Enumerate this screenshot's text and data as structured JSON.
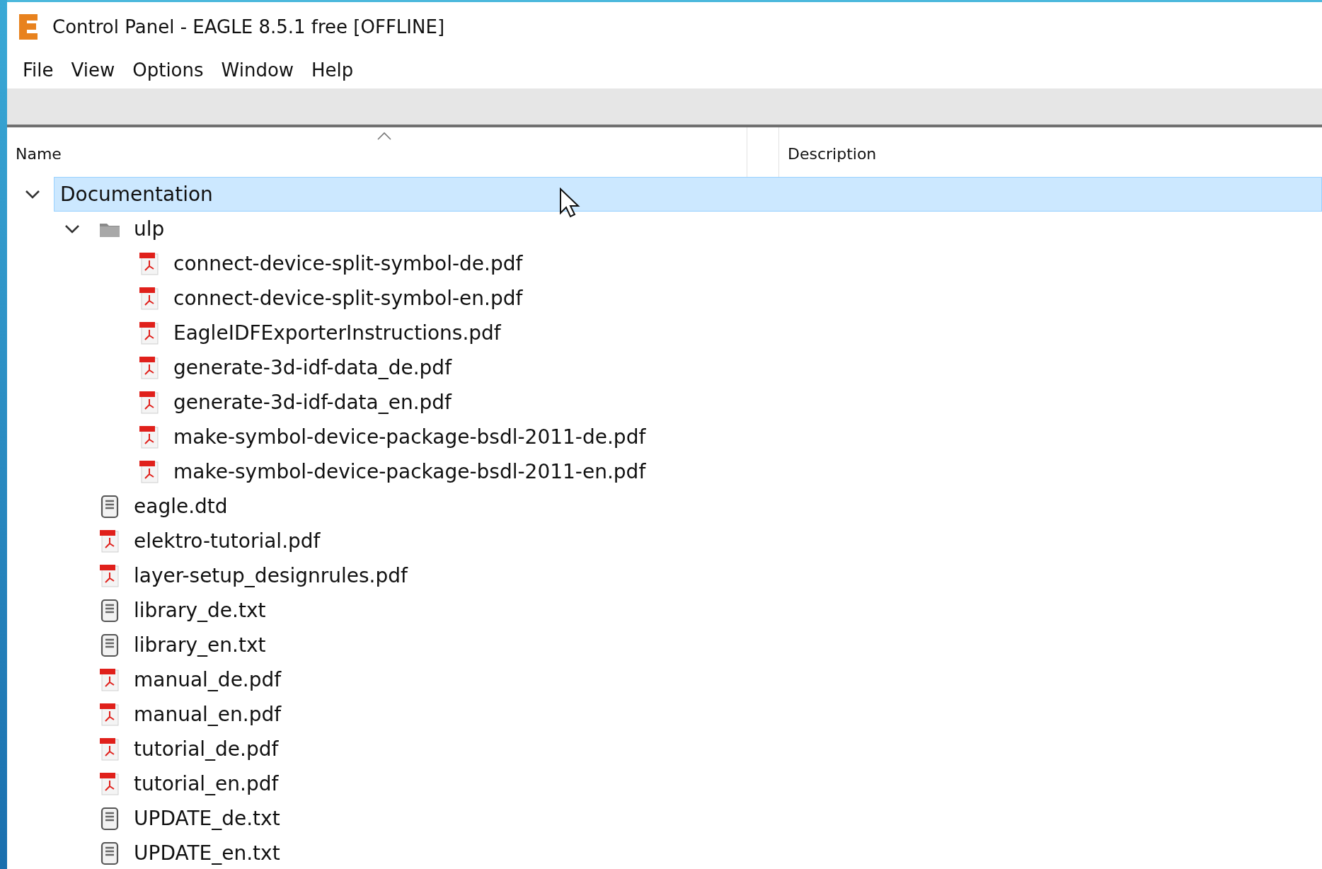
{
  "window": {
    "title": "Control Panel - EAGLE 8.5.1 free [OFFLINE]"
  },
  "menu": [
    "File",
    "View",
    "Options",
    "Window",
    "Help"
  ],
  "columns": [
    {
      "label": "Name",
      "sorted": true
    },
    {
      "label": "Description",
      "sorted": false
    }
  ],
  "tree": [
    {
      "name": "Documentation",
      "expanded": true,
      "selected": true,
      "children": [
        {
          "name": "ulp",
          "kind": "folder",
          "expanded": true,
          "selected": false,
          "children": [
            {
              "name": "connect-device-split-symbol-de.pdf",
              "kind": "pdf",
              "selected": false
            },
            {
              "name": "connect-device-split-symbol-en.pdf",
              "kind": "pdf",
              "selected": false
            },
            {
              "name": "EagleIDFExporterInstructions.pdf",
              "kind": "pdf",
              "selected": false
            },
            {
              "name": "generate-3d-idf-data_de.pdf",
              "kind": "pdf",
              "selected": false
            },
            {
              "name": "generate-3d-idf-data_en.pdf",
              "kind": "pdf",
              "selected": false
            },
            {
              "name": "make-symbol-device-package-bsdl-2011-de.pdf",
              "kind": "pdf",
              "selected": false
            },
            {
              "name": "make-symbol-device-package-bsdl-2011-en.pdf",
              "kind": "pdf",
              "selected": false
            }
          ]
        },
        {
          "name": "eagle.dtd",
          "kind": "text",
          "selected": false
        },
        {
          "name": "elektro-tutorial.pdf",
          "kind": "pdf",
          "selected": false
        },
        {
          "name": "layer-setup_designrules.pdf",
          "kind": "pdf",
          "selected": false
        },
        {
          "name": "library_de.txt",
          "kind": "text",
          "selected": false
        },
        {
          "name": "library_en.txt",
          "kind": "text",
          "selected": false
        },
        {
          "name": "manual_de.pdf",
          "kind": "pdf",
          "selected": false
        },
        {
          "name": "manual_en.pdf",
          "kind": "pdf",
          "selected": false
        },
        {
          "name": "tutorial_de.pdf",
          "kind": "pdf",
          "selected": false
        },
        {
          "name": "tutorial_en.pdf",
          "kind": "pdf",
          "selected": false
        },
        {
          "name": "UPDATE_de.txt",
          "kind": "text",
          "selected": false
        },
        {
          "name": "UPDATE_en.txt",
          "kind": "text",
          "selected": false
        }
      ]
    }
  ]
}
